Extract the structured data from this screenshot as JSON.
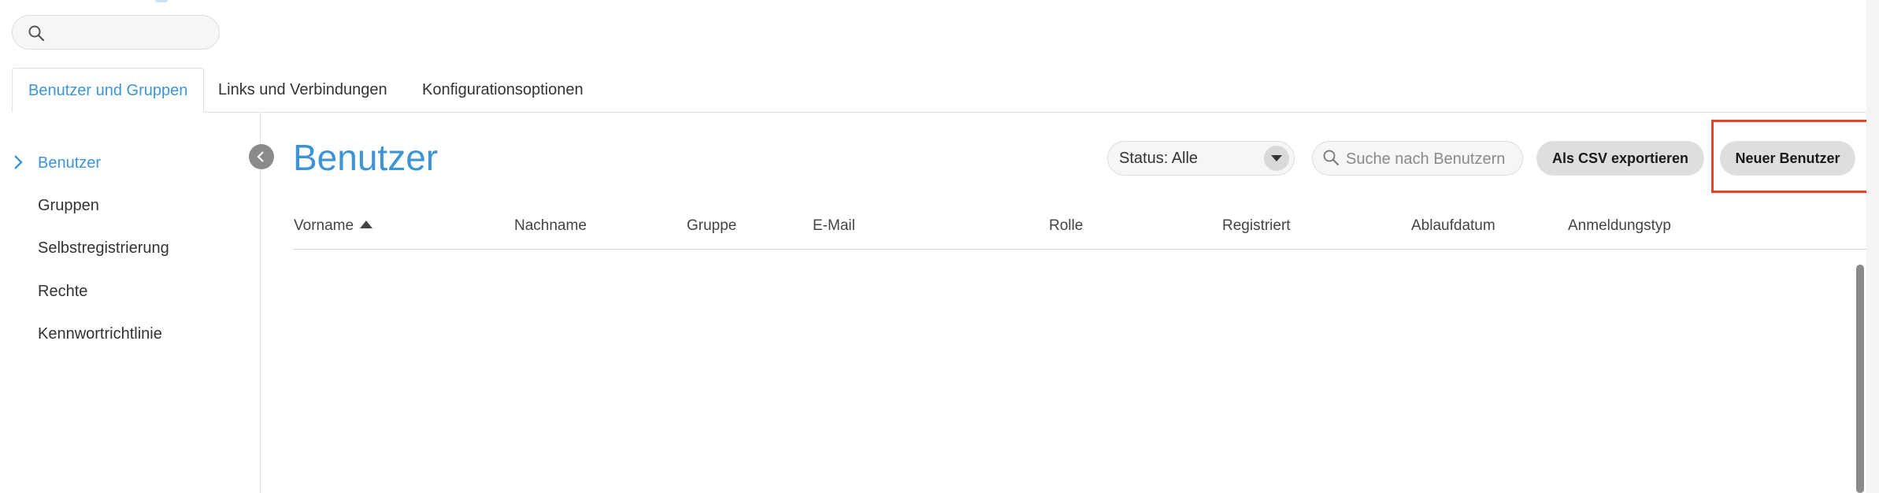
{
  "global_search": {
    "placeholder": ""
  },
  "tabs": [
    {
      "label": "Benutzer und Gruppen",
      "active": true
    },
    {
      "label": "Links und Verbindungen",
      "active": false
    },
    {
      "label": "Konfigurationsoptionen",
      "active": false
    }
  ],
  "sidebar": {
    "items": [
      {
        "label": "Benutzer",
        "active": true
      },
      {
        "label": "Gruppen",
        "active": false
      },
      {
        "label": "Selbstregistrierung",
        "active": false
      },
      {
        "label": "Rechte",
        "active": false
      },
      {
        "label": "Kennwortrichtlinie",
        "active": false
      }
    ]
  },
  "main": {
    "title": "Benutzer",
    "status_filter": {
      "value": "Status: Alle"
    },
    "user_search": {
      "placeholder": "Suche nach Benutzern"
    },
    "csv_button": "Als CSV exportieren",
    "new_user_button": "Neuer Benutzer",
    "table": {
      "columns": [
        "Vorname",
        "Nachname",
        "Gruppe",
        "E-Mail",
        "Rolle",
        "Registriert",
        "Ablaufdatum",
        "Anmeldungstyp"
      ],
      "sort_column": "Vorname",
      "sort_direction": "ascending",
      "rows": []
    }
  },
  "colors": {
    "accent": "#3d95d6",
    "highlight": "#e8412c",
    "button_bg": "#dedede"
  }
}
